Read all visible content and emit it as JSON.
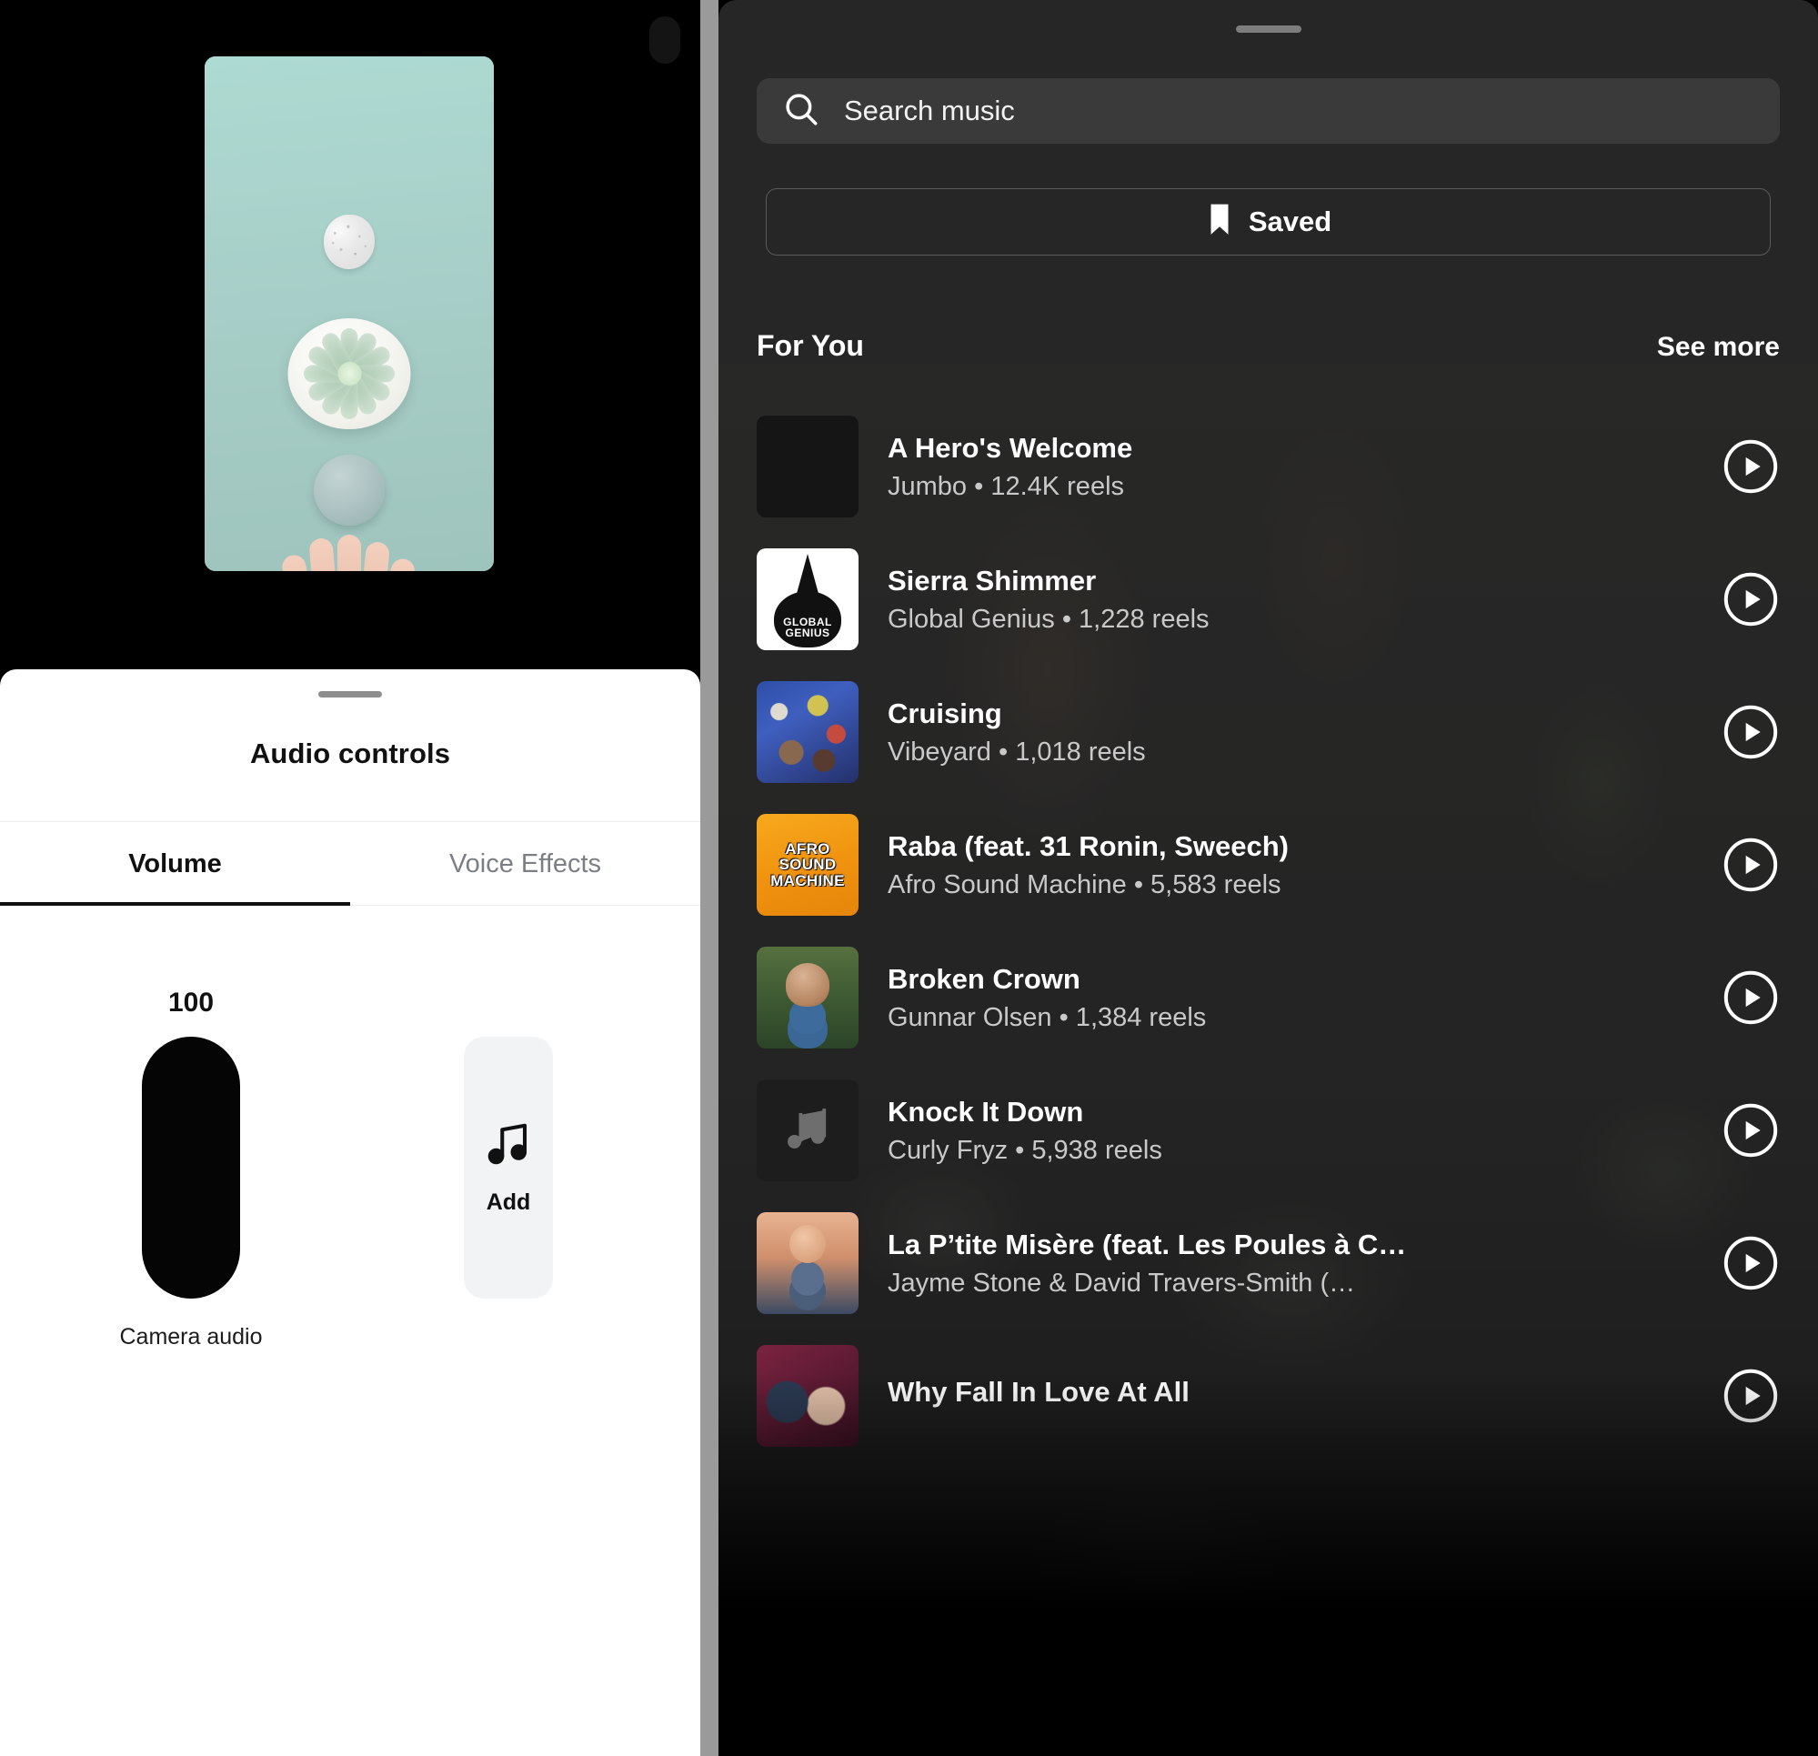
{
  "left_panel": {
    "audio_sheet": {
      "title": "Audio controls",
      "tabs": [
        {
          "label": "Volume",
          "active": true
        },
        {
          "label": "Voice Effects",
          "active": false
        }
      ],
      "volume": {
        "value": "100",
        "value_number": 100,
        "track_label": "Camera audio"
      },
      "add_button": {
        "label": "Add",
        "icon": "music-note-icon"
      },
      "grabber_icon": "drag-handle-icon"
    },
    "preview": {
      "icon": "video-preview",
      "description": "Flat-lay of succulent in white pot on mint background with hand holding stone"
    }
  },
  "right_panel": {
    "grabber_icon": "drag-handle-icon",
    "search": {
      "icon": "search-icon",
      "placeholder": "Search music",
      "value": ""
    },
    "saved_button": {
      "icon": "bookmark-icon",
      "label": "Saved"
    },
    "section": {
      "title": "For You",
      "see_more_label": "See more"
    },
    "tracks": [
      {
        "title": "A Hero's Welcome",
        "artist": "Jumbo",
        "reels": "12.4K reels",
        "subtitle": "Jumbo • 12.4K reels",
        "art": "blank",
        "play_icon": "play-circle-icon"
      },
      {
        "title": "Sierra Shimmer",
        "artist": "Global Genius",
        "reels": "1,228 reels",
        "subtitle": "Global Genius • 1,228 reels",
        "art": "globalgenius",
        "art_text_line1": "GLOBAL",
        "art_text_line2": "GENIUS",
        "play_icon": "play-circle-icon"
      },
      {
        "title": "Cruising",
        "artist": "Vibeyard",
        "reels": "1,018 reels",
        "subtitle": "Vibeyard • 1,018 reels",
        "art": "cruising",
        "play_icon": "play-circle-icon"
      },
      {
        "title": "Raba (feat. 31 Ronin, Sweech)",
        "artist": "Afro Sound Machine",
        "reels": "5,583 reels",
        "subtitle": "Afro Sound Machine • 5,583 reels",
        "art": "afro",
        "art_text_line1": "AFRO",
        "art_text_line2": "SOUND",
        "art_text_line3": "MACHINE",
        "play_icon": "play-circle-icon"
      },
      {
        "title": "Broken Crown",
        "artist": "Gunnar Olsen",
        "reels": "1,384 reels",
        "subtitle": "Gunnar Olsen • 1,384 reels",
        "art": "broken",
        "play_icon": "play-circle-icon"
      },
      {
        "title": "Knock It Down",
        "artist": "Curly Fryz",
        "reels": "5,938 reels",
        "subtitle": "Curly Fryz • 5,938 reels",
        "art": "note",
        "play_icon": "play-circle-icon"
      },
      {
        "title": "La P’tite Misère (feat. Les Poules à C…",
        "artist": "Jayme Stone & David Travers-Smith (…",
        "reels": "",
        "subtitle": "Jayme Stone & David Travers-Smith (…",
        "art": "laptite",
        "play_icon": "play-circle-icon"
      },
      {
        "title": "Why Fall In Love At All",
        "artist": "",
        "reels": "",
        "subtitle": "",
        "art": "whyfall",
        "play_icon": "play-circle-icon"
      }
    ]
  },
  "colors": {
    "sheet_background": "#ffffff",
    "music_sheet_background": "#262626",
    "search_field": "#3a3a3a",
    "accent_dark": "#050505",
    "afro_orange": "#f0920f",
    "divider_gray": "#9a9a9a",
    "secondary_text": "#c9c9c9"
  }
}
